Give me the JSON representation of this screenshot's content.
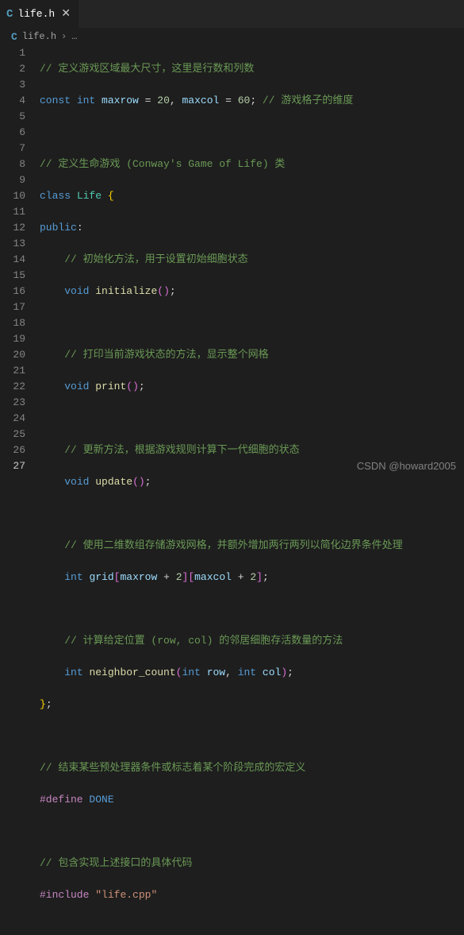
{
  "tab": {
    "icon_letter": "C",
    "filename": "life.h",
    "close_glyph": "✕"
  },
  "breadcrumb": {
    "icon_letter": "C",
    "filename": "life.h",
    "chevron": "›",
    "more": "…"
  },
  "code": {
    "l1_comment": "// 定义游戏区域最大尺寸，这里是行数和列数",
    "l2_const": "const",
    "l2_int": "int",
    "l2_maxrow": "maxrow",
    "l2_eq1": " = ",
    "l2_20": "20",
    "l2_comma": ", ",
    "l2_maxcol": "maxcol",
    "l2_eq2": " = ",
    "l2_60": "60",
    "l2_semi": "; ",
    "l2_comment": "// 游戏格子的维度",
    "l4_comment": "// 定义生命游戏 (Conway's Game of Life) 类",
    "l5_class": "class",
    "l5_name": "Life",
    "l5_brace": "{",
    "l6_public": "public",
    "l6_colon": ":",
    "l7_comment": "// 初始化方法，用于设置初始细胞状态",
    "l8_void": "void",
    "l8_func": "initialize",
    "l8_paren": "()",
    "l8_semi": ";",
    "l10_comment": "// 打印当前游戏状态的方法，显示整个网格",
    "l11_void": "void",
    "l11_func": "print",
    "l11_paren": "()",
    "l11_semi": ";",
    "l13_comment": "// 更新方法，根据游戏规则计算下一代细胞的状态",
    "l14_void": "void",
    "l14_func": "update",
    "l14_paren": "()",
    "l14_semi": ";",
    "l16_comment": "// 使用二维数组存储游戏网格，并额外增加两行两列以简化边界条件处理",
    "l17_int": "int",
    "l17_grid": "grid",
    "l17_lb1": "[",
    "l17_maxrow": "maxrow",
    "l17_plus1": " + ",
    "l17_two1": "2",
    "l17_rb1": "]",
    "l17_lb2": "[",
    "l17_maxcol": "maxcol",
    "l17_plus2": " + ",
    "l17_two2": "2",
    "l17_rb2": "]",
    "l17_semi": ";",
    "l19_comment": "// 计算给定位置 (row, col) 的邻居细胞存活数量的方法",
    "l20_int": "int",
    "l20_func": "neighbor_count",
    "l20_lp": "(",
    "l20_int1": "int",
    "l20_row": "row",
    "l20_comma": ", ",
    "l20_int2": "int",
    "l20_col": "col",
    "l20_rp": ")",
    "l20_semi": ";",
    "l21_brace": "}",
    "l21_semi": ";",
    "l23_comment": "// 结束某些预处理器条件或标志着某个阶段完成的宏定义",
    "l24_define": "#define",
    "l24_done": "DONE",
    "l26_comment": "// 包含实现上述接口的具体代码",
    "l27_include": "#include",
    "l27_str": "\"life.cpp\""
  },
  "line_numbers": [
    "1",
    "2",
    "3",
    "4",
    "5",
    "6",
    "7",
    "8",
    "9",
    "10",
    "11",
    "12",
    "13",
    "14",
    "15",
    "16",
    "17",
    "18",
    "19",
    "20",
    "21",
    "22",
    "23",
    "24",
    "25",
    "26",
    "27"
  ],
  "watermark": "CSDN @howard2005"
}
